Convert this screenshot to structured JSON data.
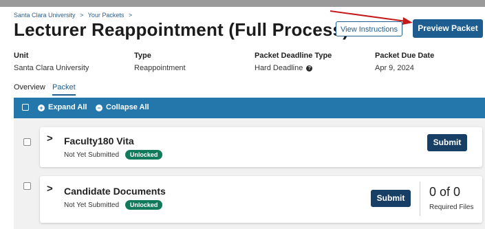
{
  "breadcrumb": {
    "item1": "Santa Clara University",
    "sep1": ">",
    "item2": "Your Packets",
    "sep2": ">"
  },
  "page": {
    "title": "Lecturer Reappointment (Full Process)"
  },
  "actions": {
    "view_instructions": "View Instructions",
    "preview_packet": "Preview Packet"
  },
  "meta": {
    "unit_label": "Unit",
    "unit_value": "Santa Clara University",
    "type_label": "Type",
    "type_value": "Reappointment",
    "deadline_type_label": "Packet Deadline Type",
    "deadline_type_value": "Hard Deadline",
    "due_label": "Packet Due Date",
    "due_value": "Apr 9, 2024"
  },
  "tabs": {
    "overview": "Overview",
    "packet": "Packet"
  },
  "toolbar": {
    "expand_all": "Expand All",
    "collapse_all": "Collapse All"
  },
  "sections": [
    {
      "title": "Faculty180 Vita",
      "status": "Not Yet Submitted",
      "badge": "Unlocked",
      "submit": "Submit"
    },
    {
      "title": "Candidate Documents",
      "status": "Not Yet Submitted",
      "badge": "Unlocked",
      "submit": "Submit",
      "count": "0 of 0",
      "count_label": "Required Files"
    }
  ],
  "colors": {
    "primary": "#1d5d8f",
    "toolbar": "#2377ab",
    "badge": "#117a5a",
    "submit": "#173f66",
    "arrow": "#c41a1a"
  }
}
